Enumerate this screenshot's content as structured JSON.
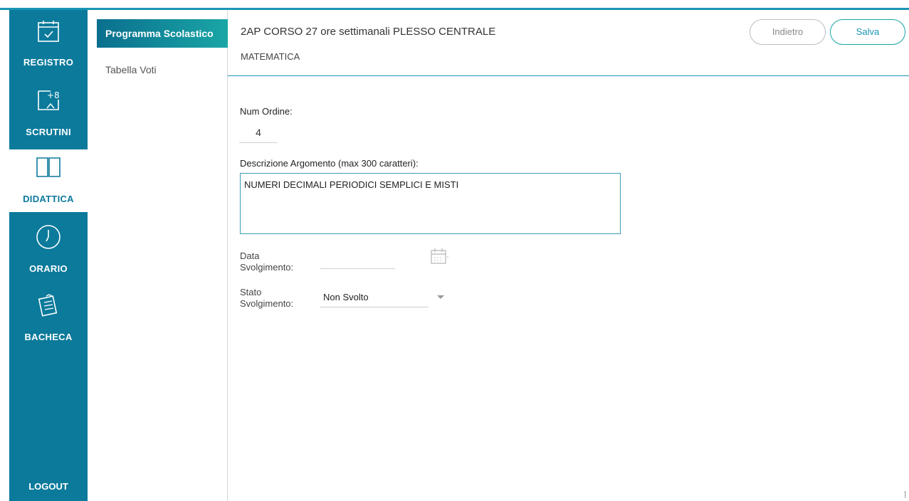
{
  "nav": {
    "registro": "REGISTRO",
    "scrutini": "SCRUTINI",
    "didattica": "DIDATTICA",
    "orario": "ORARIO",
    "bacheca": "BACHECA",
    "logout": "LOGOUT"
  },
  "subnav": {
    "items": [
      {
        "label": "Programma Scolastico",
        "active": true
      },
      {
        "label": "Tabella Voti",
        "active": false
      }
    ]
  },
  "header": {
    "title": "2AP CORSO 27 ore settimanali PLESSO CENTRALE",
    "subtitle": "MATEMATICA",
    "back_label": "Indietro",
    "save_label": "Salva"
  },
  "form": {
    "num_ordine_label": "Num Ordine:",
    "num_ordine_value": "4",
    "descrizione_label": "Descrizione Argomento (max 300 caratteri):",
    "descrizione_value": "NUMERI DECIMALI PERIODICI SEMPLICI E MISTI",
    "data_label_1": "Data",
    "data_label_2": "Svolgimento:",
    "data_value": "",
    "stato_label_1": "Stato",
    "stato_label_2": "Svolgimento:",
    "stato_value": "Non Svolto"
  },
  "colors": {
    "nav_bg": "#0b7a9b",
    "accent": "#1a95b5",
    "active_gradient_start": "#0a6f8e",
    "active_gradient_end": "#1aa6a6"
  }
}
